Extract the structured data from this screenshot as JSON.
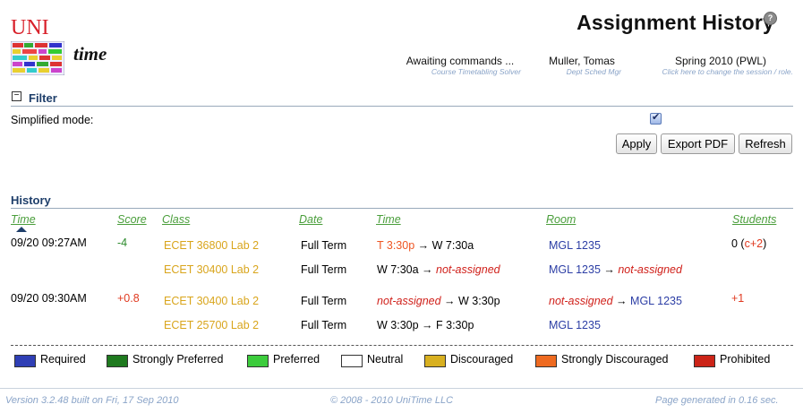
{
  "app": {
    "logo_uni": "UNI",
    "logo_time": "time",
    "page_title": "Assignment History",
    "help_glyph": "?"
  },
  "header": {
    "status_value": "Awaiting commands ...",
    "status_sub": "Course Timetabling Solver",
    "user_value": "Muller, Tomas",
    "user_sub": "Dept Sched Mgr",
    "session_value": "Spring 2010 (PWL)",
    "session_sub": "Click here to change the session / role."
  },
  "filter": {
    "title": "Filter",
    "collapse_glyph": "−",
    "simplified_label": "Simplified mode:",
    "simplified_checked": true,
    "buttons": {
      "apply": "Apply",
      "export_pdf": "Export PDF",
      "refresh": "Refresh"
    }
  },
  "history": {
    "title": "History",
    "columns": {
      "time": "Time",
      "score": "Score",
      "class": "Class",
      "date": "Date",
      "time2": "Time",
      "room": "Room",
      "students": "Students"
    },
    "rows": [
      {
        "time": "09/20 09:27AM",
        "score": "-4",
        "students_count": "0 (",
        "students_conf": "c+2",
        "students_close": ")",
        "entries": [
          {
            "class": "ECET 36800 Lab 2",
            "date": "Full Term",
            "time_from": "T 3:30p",
            "time_arrow": " → ",
            "time_to": "W 7:30a",
            "room_from": "MGL 1235",
            "room_arrow": "",
            "room_to": ""
          },
          {
            "class": "ECET 30400 Lab 2",
            "date": "Full Term",
            "time_from": "W 7:30a",
            "time_arrow": " → ",
            "time_to": "not-assigned",
            "room_from": "MGL 1235",
            "room_arrow": " → ",
            "room_to": "not-assigned"
          }
        ]
      },
      {
        "time": "09/20 09:30AM",
        "score": "+0.8",
        "students_count": "+1",
        "entries": [
          {
            "class": "ECET 30400 Lab 2",
            "date": "Full Term",
            "time_from": "not-assigned",
            "time_arrow": " → ",
            "time_to": "W 3:30p",
            "room_from": "not-assigned",
            "room_arrow": " → ",
            "room_to": "MGL 1235"
          },
          {
            "class": "ECET 25700 Lab 2",
            "date": "Full Term",
            "time_from": "W 3:30p",
            "time_arrow": " → ",
            "time_to": "F 3:30p",
            "room_from": "MGL 1235",
            "room_arrow": "",
            "room_to": ""
          }
        ]
      }
    ]
  },
  "legend": [
    {
      "label": "Required",
      "color": "#2f3fb5"
    },
    {
      "label": "Strongly Preferred",
      "color": "#1f7a1f"
    },
    {
      "label": "Preferred",
      "color": "#3ccc3c"
    },
    {
      "label": "Neutral",
      "color": "#ffffff"
    },
    {
      "label": "Discouraged",
      "color": "#d8b020"
    },
    {
      "label": "Strongly Discouraged",
      "color": "#ee6a20"
    },
    {
      "label": "Prohibited",
      "color": "#cc2418"
    }
  ],
  "footer": {
    "version": "Version 3.2.48 built on Fri, 17 Sep 2010",
    "copyright": "© 2008 - 2010 UniTime LLC",
    "generated": "Page generated in 0.16 sec."
  }
}
